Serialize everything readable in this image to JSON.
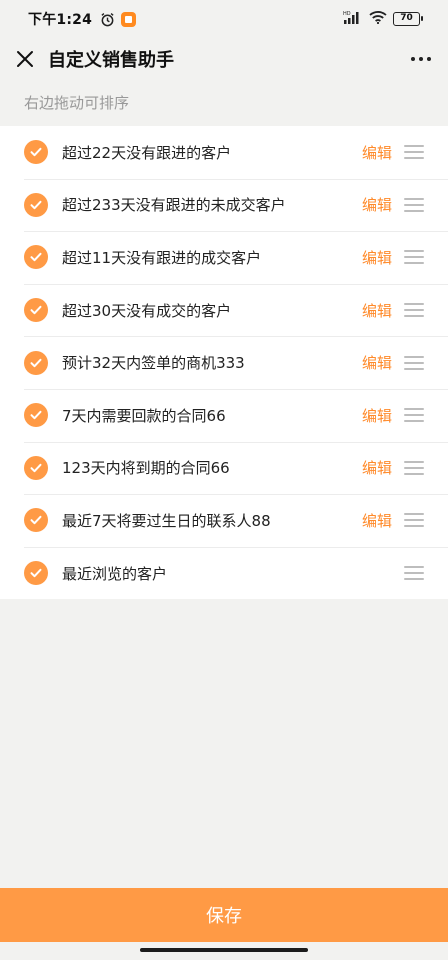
{
  "status_bar": {
    "time": "下午1:24",
    "battery": "70",
    "icons": [
      "alarm-icon",
      "app-notification-icon",
      "hd-signal-icon",
      "wifi-icon",
      "battery-icon"
    ]
  },
  "header": {
    "title": "自定义销售助手",
    "close_icon": "close-icon",
    "more_icon": "more-icon"
  },
  "hint": "右边拖动可排序",
  "items": [
    {
      "label": "超过22天没有跟进的客户",
      "checked": true,
      "edit": "编辑"
    },
    {
      "label": "超过233天没有跟进的未成交客户",
      "checked": true,
      "edit": "编辑"
    },
    {
      "label": "超过11天没有跟进的成交客户",
      "checked": true,
      "edit": "编辑"
    },
    {
      "label": "超过30天没有成交的客户",
      "checked": true,
      "edit": "编辑"
    },
    {
      "label": "预计32天内签单的商机333",
      "checked": true,
      "edit": "编辑"
    },
    {
      "label": "7天内需要回款的合同66",
      "checked": true,
      "edit": "编辑"
    },
    {
      "label": "123天内将到期的合同66",
      "checked": true,
      "edit": "编辑"
    },
    {
      "label": "最近7天将要过生日的联系人88",
      "checked": true,
      "edit": "编辑"
    },
    {
      "label": "最近浏览的客户",
      "checked": true,
      "edit": ""
    }
  ],
  "save_label": "保存",
  "colors": {
    "accent": "#ff9a45",
    "edit_text": "#ff8a2a",
    "background": "#f2f2f0"
  }
}
